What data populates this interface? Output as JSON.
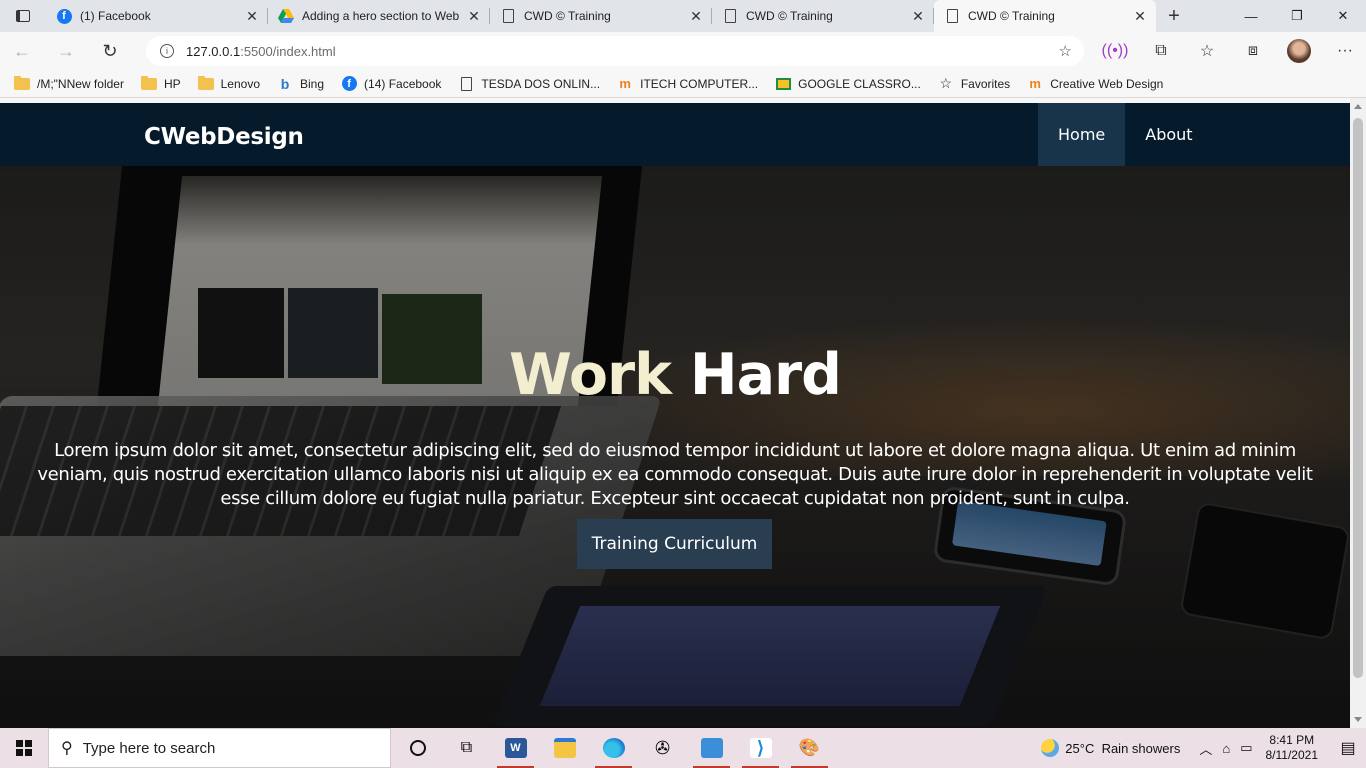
{
  "browser": {
    "tabs": [
      {
        "title": "(1) Facebook",
        "icon": "facebook-icon",
        "active": false
      },
      {
        "title": "Adding a hero section to Web",
        "icon": "google-drive-icon",
        "active": false
      },
      {
        "title": "CWD © Training",
        "icon": "page-icon",
        "active": false
      },
      {
        "title": "CWD © Training",
        "icon": "page-icon",
        "active": false
      },
      {
        "title": "CWD © Training",
        "icon": "page-icon",
        "active": true
      }
    ],
    "address": {
      "host": "127.0.0.1",
      "path": ":5500/index.html"
    },
    "bookmarks": [
      {
        "label": "/M;\"NNew folder",
        "icon": "folder-icon"
      },
      {
        "label": "HP",
        "icon": "folder-icon"
      },
      {
        "label": "Lenovo",
        "icon": "folder-icon"
      },
      {
        "label": "Bing",
        "icon": "bing-icon"
      },
      {
        "label": "(14) Facebook",
        "icon": "facebook-icon"
      },
      {
        "label": "TESDA DOS ONLIN...",
        "icon": "page-icon"
      },
      {
        "label": "ITECH COMPUTER...",
        "icon": "moodle-icon"
      },
      {
        "label": "GOOGLE CLASSRO...",
        "icon": "classroom-icon"
      },
      {
        "label": "Favorites",
        "icon": "star-icon"
      },
      {
        "label": "Creative Web Design",
        "icon": "moodle-icon"
      }
    ]
  },
  "site": {
    "brand": "CWebDesign",
    "menu": [
      {
        "label": "Home",
        "active": true
      },
      {
        "label": "About",
        "active": false
      }
    ],
    "hero": {
      "title_accent": "Work",
      "title_rest": " Hard",
      "text": "Lorem ipsum dolor sit amet, consectetur adipiscing elit, sed do eiusmod tempor incididunt ut labore et dolore magna aliqua. Ut enim ad minim veniam, quis nostrud exercitation ullamco laboris nisi ut aliquip ex ea commodo consequat. Duis aute irure dolor in reprehenderit in voluptate velit esse cillum dolore eu fugiat nulla pariatur. Excepteur sint occaecat cupidatat non proident, sunt in culpa.",
      "button": "Training Curriculum"
    },
    "colors": {
      "nav_bg": "#051b2c",
      "nav_active": "#17344a",
      "button_bg": "#2a3e52",
      "title_accent": "#f2eecf"
    }
  },
  "taskbar": {
    "search_placeholder": "Type here to search",
    "apps": [
      "task-view-icon",
      "word-icon",
      "file-explorer-icon",
      "edge-icon",
      "film-icon",
      "control-panel-icon",
      "vscode-icon",
      "paint-icon"
    ],
    "weather": {
      "temp": "25°C",
      "desc": "Rain showers"
    },
    "time": "8:41 PM",
    "date": "8/11/2021"
  }
}
